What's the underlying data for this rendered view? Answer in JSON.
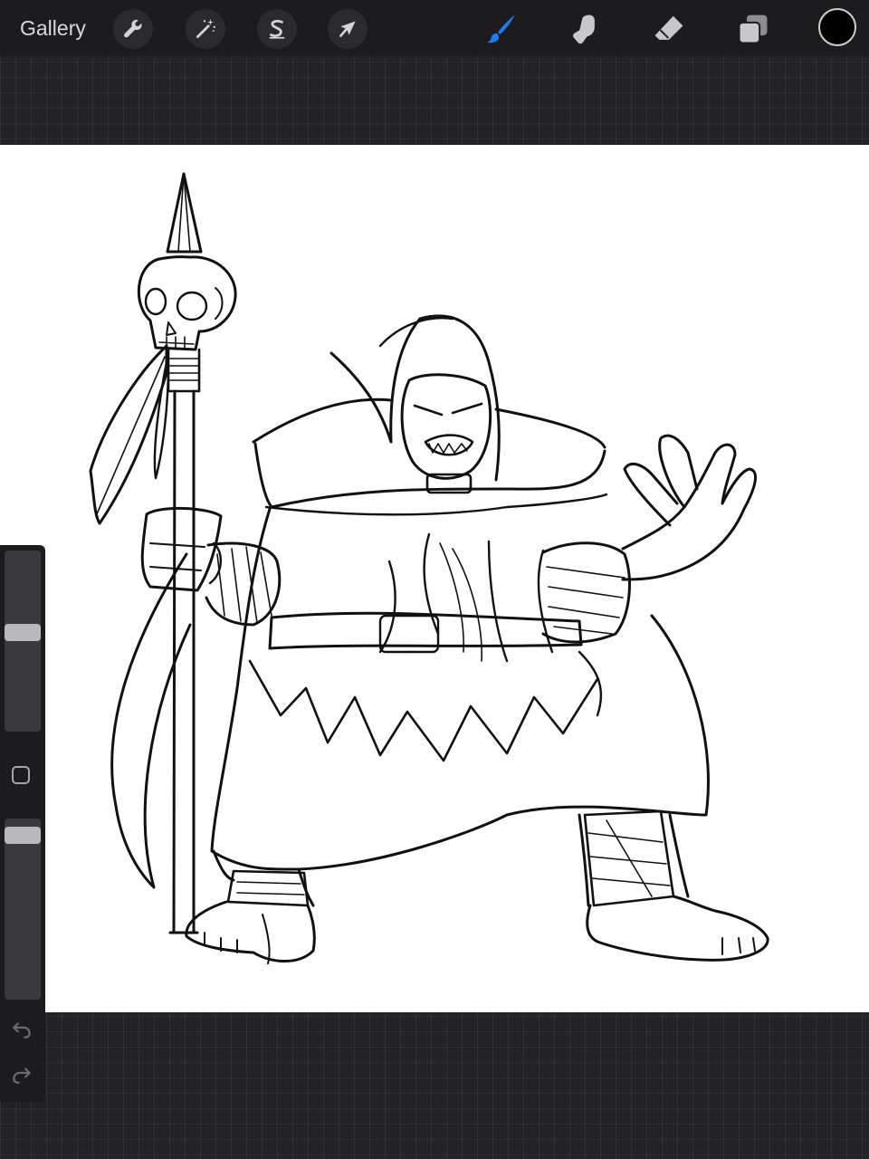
{
  "topbar": {
    "gallery_label": "Gallery",
    "actions_icon": "wrench-icon",
    "adjustments_icon": "magic-wand-icon",
    "selection_icon": "selection-s-icon",
    "transform_icon": "arrow-cursor-icon",
    "brush_icon": "brush-icon",
    "smudge_icon": "smudge-finger-icon",
    "eraser_icon": "eraser-icon",
    "layers_icon": "layers-icon",
    "active_tool": "brush",
    "accent_color": "#1e7cf0",
    "current_color": "#000000"
  },
  "sidebar": {
    "brush_size_level": 0.55,
    "opacity_level": 0.95,
    "modify_icon": "square-modify-icon",
    "undo_icon": "undo-icon",
    "redo_icon": "redo-icon"
  },
  "canvas": {
    "background": "#ffffff"
  }
}
